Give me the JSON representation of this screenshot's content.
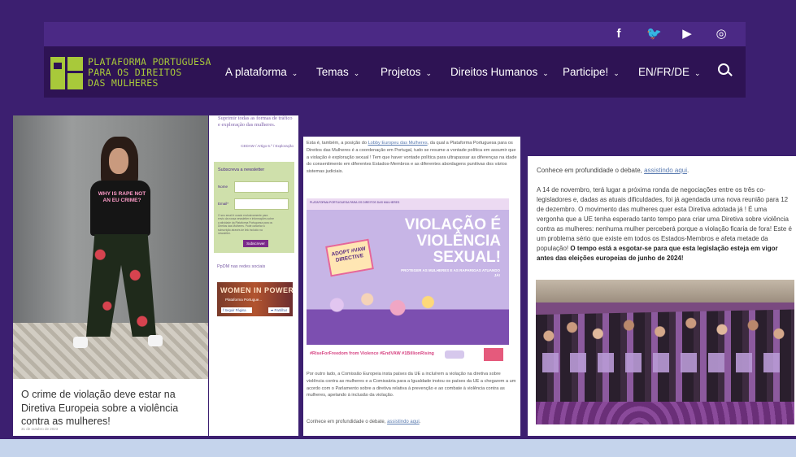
{
  "colors": {
    "brand_purple": "#2e1354",
    "topbar_purple": "#4b2985",
    "brand_green": "#a8c93a",
    "link_blue": "#5a7bb0"
  },
  "header": {
    "social": [
      {
        "icon": "facebook-icon",
        "glyph": "f"
      },
      {
        "icon": "twitter-icon",
        "glyph": "🐦"
      },
      {
        "icon": "youtube-icon",
        "glyph": "▶"
      },
      {
        "icon": "instagram-icon",
        "glyph": "◎"
      }
    ],
    "brand_lines": [
      "PLATAFORMA PORTUGUESA",
      "PARA OS DIREITOS",
      "DAS MULHERES"
    ],
    "nav": [
      "A plataforma",
      "Temas",
      "Projetos",
      "Direitos Humanos",
      "Participe!",
      "EN/FR/DE"
    ],
    "chevron": "⌄",
    "search_icon": "search-icon"
  },
  "panel1": {
    "shirt_text": "WHY IS RAPE NOT AN EU CRIME?",
    "title": "O crime de violação deve estar na Diretiva Europeia sobre a violência contra as mulheres!",
    "date": "31 de outubro de 2023"
  },
  "panel2": {
    "heading": "Suprimir todas as formas de tráfico e exploração das mulheres.",
    "tags": "CEDAW / Artigo 6.º / Exploração",
    "newsletter_title": "Subscreva a newsletter",
    "name_label": "Nome",
    "email_label": "Email*",
    "fine_print": "O seu email é usado exclusivamente para envio da nossa newsletter e informações sobre a atividade da Plataforma Portuguesa para os Direitos das Mulheres. Pode cancelar a subscrição através de link incluído na newsletter.",
    "subscribe": "Subscrever",
    "social_title": "PpDM nas redes sociais",
    "fb_name": "WOMEN IN POWER",
    "fb_sub": "Plataforma Portugue...",
    "fb_follow": "f Seguir Página",
    "fb_share": "➦ Partilhar"
  },
  "panel3": {
    "para1_a": "Esta é, também, a posição do ",
    "para1_link": "Lobby Europeu das Mulheres",
    "para1_b": ", da qual a Plataforma Portuguesa para os Direitos das Mulheres é a coordenação em Portugal, tudo se resume a vontade política em assumir que a violação é exploração sexual ! Tem que haver vontade política para ultrapassar as diferenças na idade do consentimento em diferentes Estados-Membros e as diferentes abordagens punitivas dos vários sistemas judiciais.",
    "poster_band": "PLATAFORMA PORTUGUESA PARA OS DIREITOS DAS MULHERES",
    "poster_headline": "VIOLAÇÃO É VIOLÊNCIA SEXUAL!",
    "poster_sub": "PROTEGER AS MULHERES E AS RAPARIGAS ATUANDO JÁ!",
    "poster_sign": "ADOPT #VAW DIRECTIVE",
    "poster_hashtags": "#RiseForFreedom from Violence #EndVAW #1BillionRising",
    "para2": "Por outro lado, a Comissão Europeia  insta países da UE a incluírem a violação na diretiva sobre violência contra as mulheres e a Comissária para a Igualdade instou os países da UE a chegarem a um acordo com o Parlamento sobre a diretiva relativa à prevenção e ao combate à violência contra as mulheres, apelando à inclusão da violação.",
    "more_a": "Conhece em profundidade o debate, ",
    "more_link": "assistindo aqui",
    "more_b": "."
  },
  "panel4": {
    "intro_a": "Conhece em profundidade o debate, ",
    "intro_link": "assistindo aqui",
    "intro_b": ".",
    "body": "A 14 de novembro, terá lugar a próxima ronda de negociações entre os três co-legisladores e, dadas as atuais dificuldades, foi já agendada uma nova reunião para 12 de dezembro. O movimento das mulheres quer esta Diretiva adotada já ! É uma vergonha que a UE tenha esperado tanto tempo para criar uma Diretiva sobre violência contra as mulheres: nenhuma mulher perceberá porque a violação ficaria de fora! Este é um problema sério que existe em todos os Estados-Membros e afeta metade da população! ",
    "body_bold": "O tempo está a esgotar-se para que esta legislação esteja em vigor antes das eleições europeias de junho de 2024!"
  }
}
